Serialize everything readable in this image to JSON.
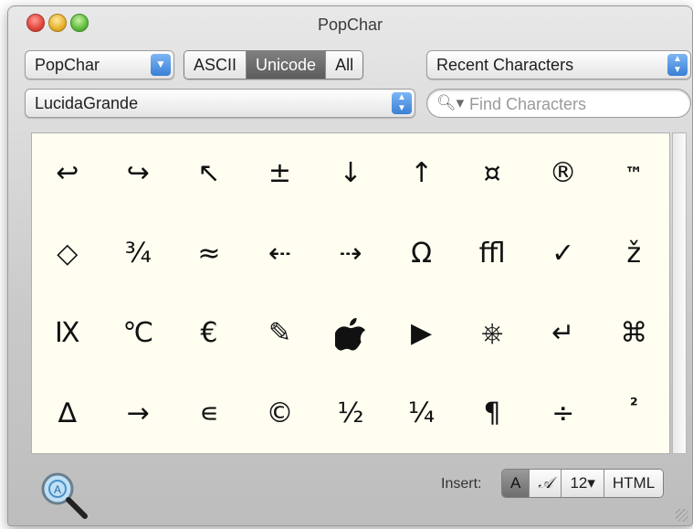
{
  "window": {
    "title": "PopChar"
  },
  "toolbar": {
    "app_menu": "PopChar",
    "modes": [
      "ASCII",
      "Unicode",
      "All"
    ],
    "active_mode": "Unicode",
    "view_selector": "Recent Characters",
    "font_selector": "LucidaGrande",
    "search_placeholder": "Find Characters"
  },
  "characters": [
    [
      "↩",
      "↪",
      "↖",
      "±",
      "↓",
      "↑",
      "¤",
      "®",
      "™"
    ],
    [
      "◇",
      "¾",
      "≈",
      "⇠",
      "⇢",
      "Ω",
      "ﬄ",
      "✓",
      "ž"
    ],
    [
      "Ⅸ",
      "℃",
      "€",
      "✎",
      "",
      "▶",
      "⎈",
      "↵",
      "⌘"
    ],
    [
      "∆",
      "→",
      "∊",
      "©",
      "½",
      "¼",
      "¶",
      "÷",
      "²"
    ]
  ],
  "footer": {
    "insert_label": "Insert:",
    "insert_options": [
      "A",
      "𝒜",
      "12▾",
      "HTML"
    ],
    "active_insert": "A"
  },
  "icons": {
    "magnifier": "magnifier-icon",
    "apple": "apple-logo-icon"
  },
  "colors": {
    "grid_background": "#fffef1",
    "selected_segment": "#6a6a6a",
    "popup_arrow": "#3a80d6"
  }
}
